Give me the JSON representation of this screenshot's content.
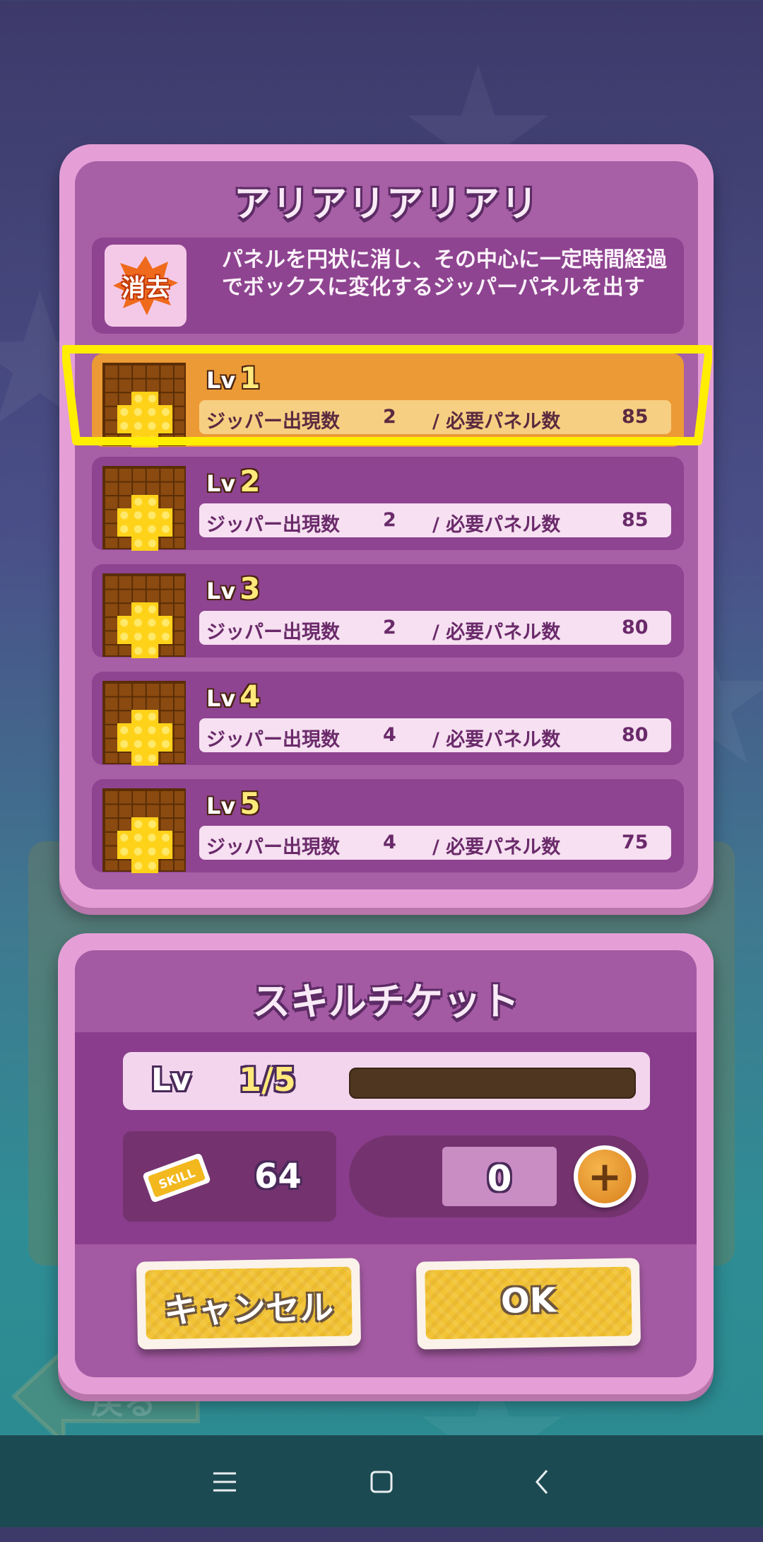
{
  "skill": {
    "title": "アリアリアリアリ",
    "icon_label": "消去",
    "description": "パネルを円状に消し、その中心に一定時間経過でボックスに変化するジッパーパネルを出す",
    "levels": [
      {
        "lv": "1",
        "stat1_label": "ジッパー出現数",
        "stat1_value": "2",
        "stat2_label": "/ 必要パネル数",
        "stat2_value": "85"
      },
      {
        "lv": "2",
        "stat1_label": "ジッパー出現数",
        "stat1_value": "2",
        "stat2_label": "/ 必要パネル数",
        "stat2_value": "85"
      },
      {
        "lv": "3",
        "stat1_label": "ジッパー出現数",
        "stat1_value": "2",
        "stat2_label": "/ 必要パネル数",
        "stat2_value": "80"
      },
      {
        "lv": "4",
        "stat1_label": "ジッパー出現数",
        "stat1_value": "4",
        "stat2_label": "/ 必要パネル数",
        "stat2_value": "80"
      },
      {
        "lv": "5",
        "stat1_label": "ジッパー出現数",
        "stat1_value": "4",
        "stat2_label": "/ 必要パネル数",
        "stat2_value": "75"
      }
    ],
    "lv_prefix": "Lv",
    "active_level": "1"
  },
  "ticket": {
    "title": "スキルチケット",
    "lv_label": "Lv",
    "lv_value": "1/5",
    "progress": 0.0,
    "ticket_icon_label": "SKILL",
    "ticket_count": "64",
    "use_value": "0",
    "cancel_label": "キャンセル",
    "ok_label": "OK"
  },
  "background": {
    "back_label": "戻る"
  },
  "colors": {
    "panel_outer": "#e59fd6",
    "panel_inner": "#a75fa6",
    "row_bg": "#8e4490",
    "row_active": "#ec9a35",
    "highlight": "#ffee00",
    "button": "#f2c334"
  },
  "icons": [
    "skill-erase-icon",
    "zipper-cross-icon",
    "skill-ticket-icon",
    "plus-icon",
    "menu-icon",
    "home-icon",
    "back-icon"
  ]
}
